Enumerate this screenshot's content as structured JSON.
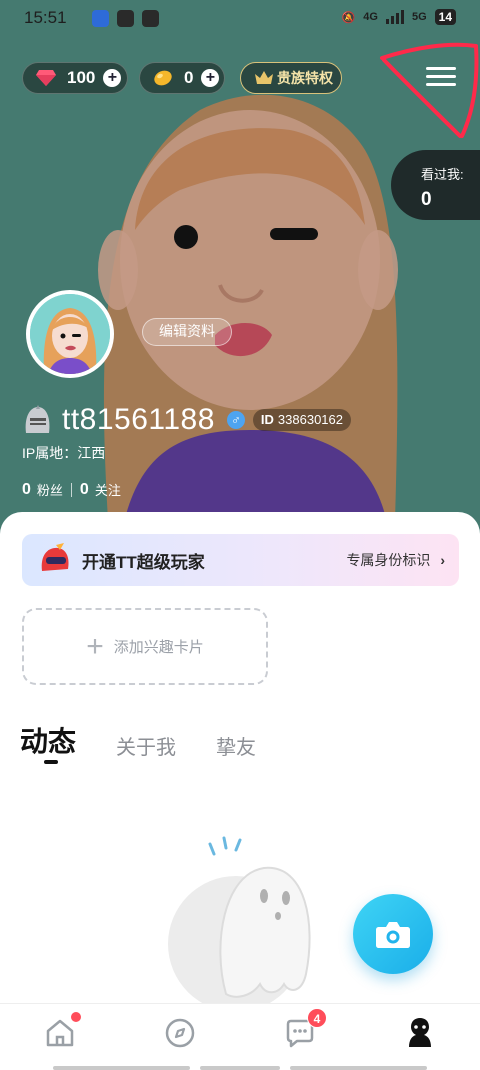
{
  "status_bar": {
    "time": "15:51",
    "network": "4G",
    "network2": "5G",
    "battery": "14"
  },
  "header": {
    "gems": "100",
    "beans": "0",
    "noble_label": "贵族特权",
    "viewed_label": "看过我:",
    "viewed_count": "0"
  },
  "profile": {
    "edit_label": "编辑资料",
    "username": "tt81561188",
    "gender_symbol": "♂",
    "id_prefix": "ID",
    "id_value": "338630162",
    "ip_label": "IP属地：江西",
    "fans_count": "0",
    "fans_label": "粉丝",
    "follow_count": "0",
    "follow_label": "关注"
  },
  "vip_banner": {
    "title": "开通TT超级玩家",
    "right_text": "专属身份标识",
    "arrow": "›"
  },
  "interest_card": {
    "label": "添加兴趣卡片"
  },
  "tabs": [
    {
      "label": "动态",
      "active": true
    },
    {
      "label": "关于我",
      "active": false
    },
    {
      "label": "挚友",
      "active": false
    }
  ],
  "bottom_nav": {
    "message_badge": "4"
  },
  "colors": {
    "cover_bg": "#457a70",
    "accent_blue": "#1aaee9",
    "badge_red": "#ff4d5a",
    "annotation_red": "#ff2a4a"
  }
}
